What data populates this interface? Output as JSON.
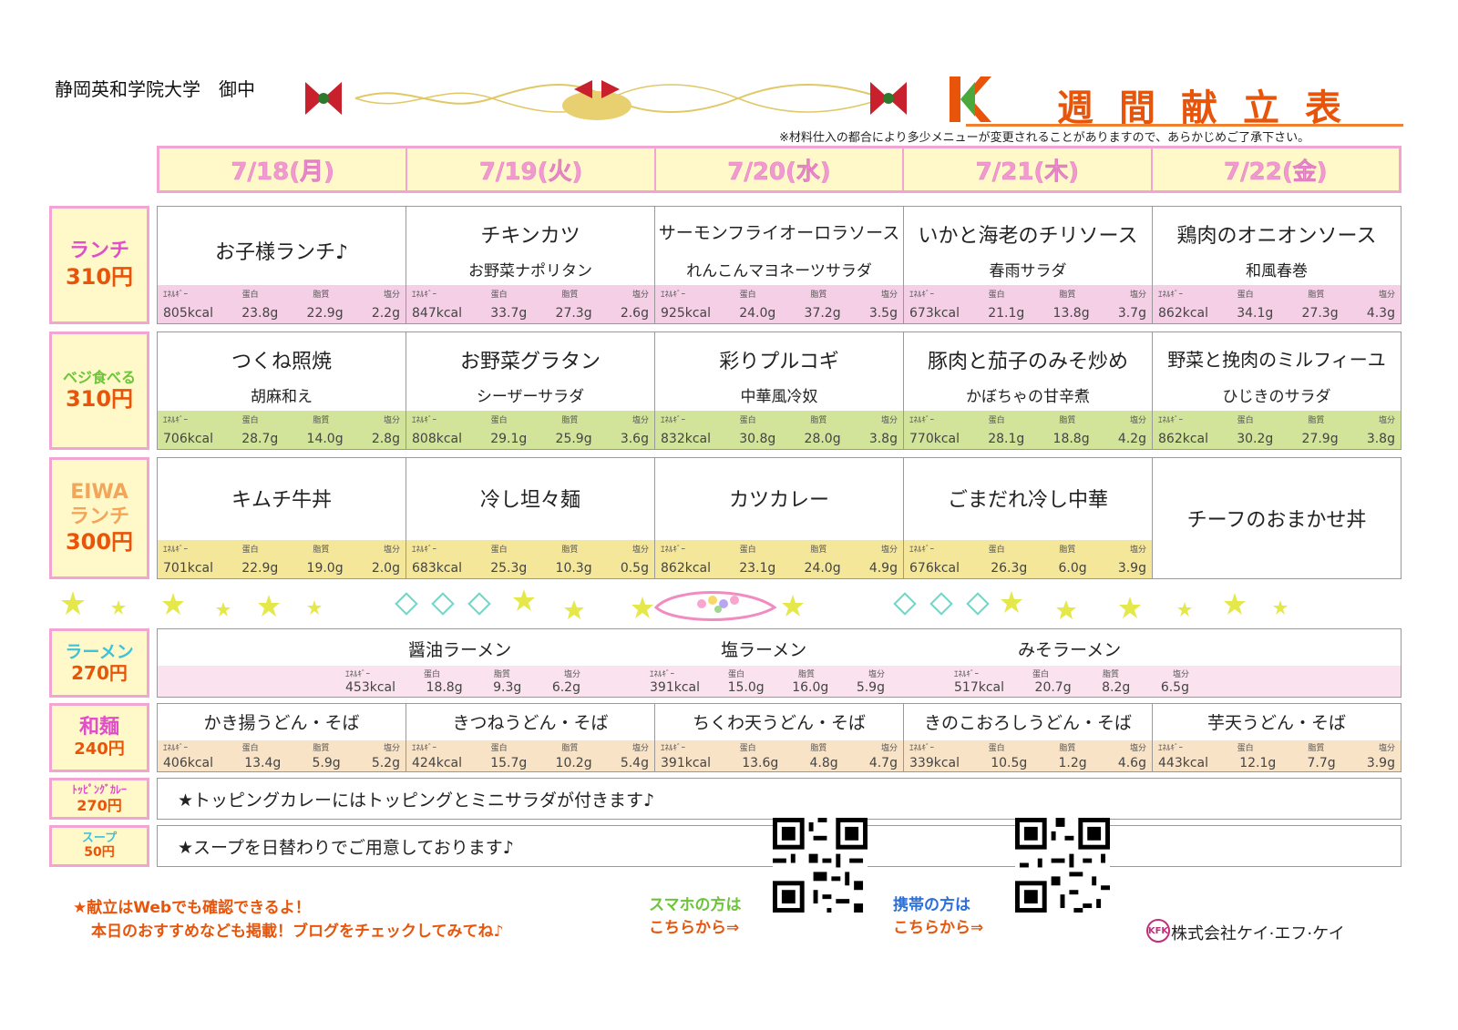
{
  "header": {
    "client": "静岡英和学院大学　御中",
    "title": "週間献立表",
    "note": "※材料仕入の都合により多少メニューが変更されることがありますので、あらかじめご了承下さい。"
  },
  "days": [
    "7/18(月)",
    "7/19(火)",
    "7/20(水)",
    "7/21(木)",
    "7/22(金)"
  ],
  "nutrition_labels": [
    "ｴﾈﾙｷﾞｰ",
    "蛋白",
    "脂質",
    "塩分"
  ],
  "categories": {
    "lunch": {
      "name": "ランチ",
      "price": "310円",
      "color": "#e04fc8"
    },
    "veggie": {
      "name": "ベジ食べる",
      "price": "310円",
      "color": "#6cc43a"
    },
    "eiwa": {
      "name1": "EIWA",
      "name2": "ランチ",
      "price": "300円",
      "color": "#f2a65a"
    },
    "ramen": {
      "name": "ラーメン",
      "price": "270円",
      "color": "#3ec2d8"
    },
    "wamen": {
      "name": "和麺",
      "price": "240円",
      "color": "#e04fc8"
    },
    "curry": {
      "name": "ﾄｯﾋﾟﾝｸﾞｶﾚｰ",
      "price": "270円",
      "color": "#e04fc8"
    },
    "soup": {
      "name": "スープ",
      "price": "50円",
      "color": "#3ec2d8"
    }
  },
  "lunch": [
    {
      "main": "お子様ランチ♪",
      "side": "",
      "nut": [
        "805kcal",
        "23.8g",
        "22.9g",
        "2.2g"
      ]
    },
    {
      "main": "チキンカツ",
      "side": "お野菜ナポリタン",
      "nut": [
        "847kcal",
        "33.7g",
        "27.3g",
        "2.6g"
      ]
    },
    {
      "main": "サーモンフライオーロラソース",
      "side": "れんこんマヨネーツサラダ",
      "nut": [
        "925kcal",
        "24.0g",
        "37.2g",
        "3.5g"
      ]
    },
    {
      "main": "いかと海老のチリソース",
      "side": "春雨サラダ",
      "nut": [
        "673kcal",
        "21.1g",
        "13.8g",
        "3.7g"
      ]
    },
    {
      "main": "鶏肉のオニオンソース",
      "side": "和風春巻",
      "nut": [
        "862kcal",
        "34.1g",
        "27.3g",
        "4.3g"
      ]
    }
  ],
  "veggie": [
    {
      "main": "つくね照焼",
      "side": "胡麻和え",
      "nut": [
        "706kcal",
        "28.7g",
        "14.0g",
        "2.8g"
      ]
    },
    {
      "main": "お野菜グラタン",
      "side": "シーザーサラダ",
      "nut": [
        "808kcal",
        "29.1g",
        "25.9g",
        "3.6g"
      ]
    },
    {
      "main": "彩りプルコギ",
      "side": "中華風冷奴",
      "nut": [
        "832kcal",
        "30.8g",
        "28.0g",
        "3.8g"
      ]
    },
    {
      "main": "豚肉と茄子のみそ炒め",
      "side": "かぼちゃの甘辛煮",
      "nut": [
        "770kcal",
        "28.1g",
        "18.8g",
        "4.2g"
      ]
    },
    {
      "main": "野菜と挽肉のミルフィーユ",
      "side": "ひじきのサラダ",
      "nut": [
        "862kcal",
        "30.2g",
        "27.9g",
        "3.8g"
      ]
    }
  ],
  "eiwa": [
    {
      "main": "キムチ牛丼",
      "nut": [
        "701kcal",
        "22.9g",
        "19.0g",
        "2.0g"
      ]
    },
    {
      "main": "冷し坦々麺",
      "nut": [
        "683kcal",
        "25.3g",
        "10.3g",
        "0.5g"
      ]
    },
    {
      "main": "カツカレー",
      "nut": [
        "862kcal",
        "23.1g",
        "24.0g",
        "4.9g"
      ]
    },
    {
      "main": "ごまだれ冷し中華",
      "nut": [
        "676kcal",
        "26.3g",
        "6.0g",
        "3.9g"
      ]
    },
    {
      "main": "チーフのおまかせ丼"
    }
  ],
  "ramen": [
    {
      "name": "醤油ラーメン",
      "nut": [
        "453kcal",
        "18.8g",
        "9.3g",
        "6.2g"
      ]
    },
    {
      "name": "塩ラーメン",
      "nut": [
        "391kcal",
        "15.0g",
        "16.0g",
        "5.9g"
      ]
    },
    {
      "name": "みそラーメン",
      "nut": [
        "517kcal",
        "20.7g",
        "8.2g",
        "6.5g"
      ]
    }
  ],
  "wamen": [
    {
      "main": "かき揚うどん・そば",
      "nut": [
        "406kcal",
        "13.4g",
        "5.9g",
        "5.2g"
      ]
    },
    {
      "main": "きつねうどん・そば",
      "nut": [
        "424kcal",
        "15.7g",
        "10.2g",
        "5.4g"
      ]
    },
    {
      "main": "ちくわ天うどん・そば",
      "nut": [
        "391kcal",
        "13.6g",
        "4.8g",
        "4.7g"
      ]
    },
    {
      "main": "きのこおろしうどん・そば",
      "nut": [
        "339kcal",
        "10.5g",
        "1.2g",
        "4.6g"
      ]
    },
    {
      "main": "芋天うどん・そば",
      "nut": [
        "443kcal",
        "12.1g",
        "7.7g",
        "3.9g"
      ]
    }
  ],
  "curry_text": "★トッピングカレーにはトッピングとミニサラダが付きます♪",
  "soup_text": "★スープを日替わりでご用意しております♪",
  "footer": {
    "line1": "★献立はWebでも確認できるよ！",
    "line2": "本日のおすすめなども掲載！ブログをチェックしてみてね♪",
    "smartphone1": "スマホの方は",
    "smartphone2": "こちらから⇒",
    "mobile1": "携帯の方は",
    "mobile2": "こちらから⇒",
    "company": "株式会社ケイ·エフ·ケイ",
    "company_logo": "KFK"
  }
}
